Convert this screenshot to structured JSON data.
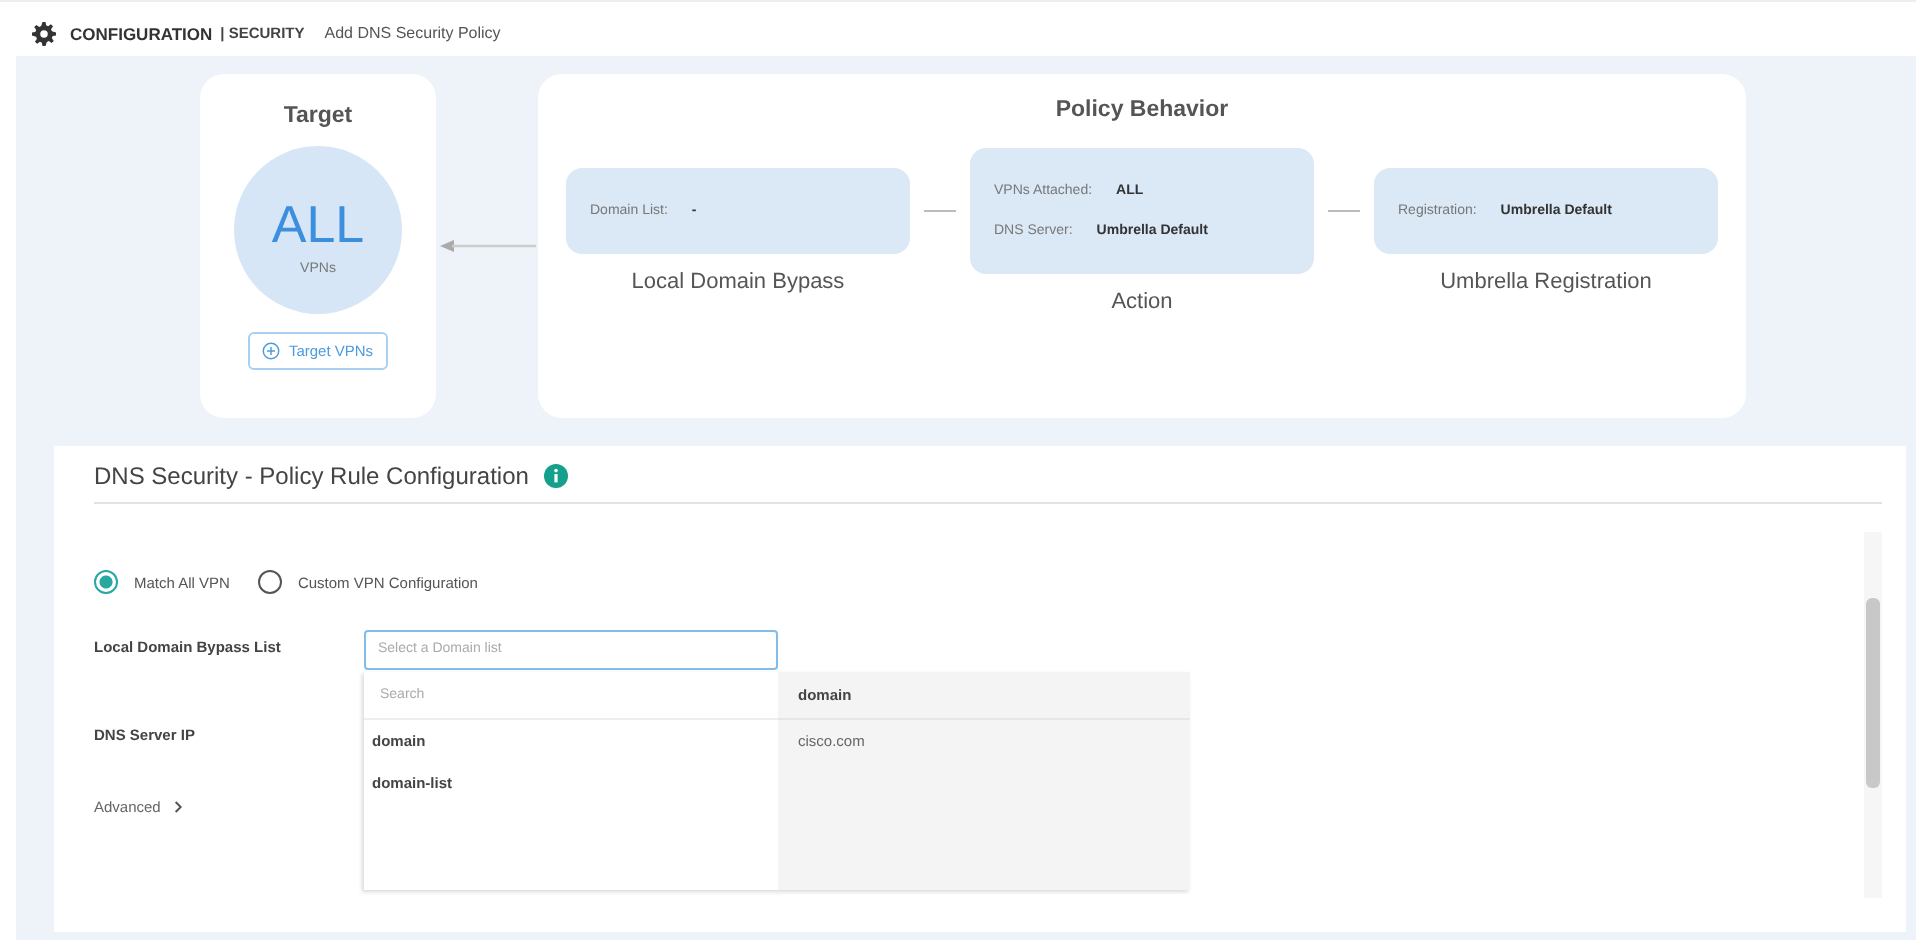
{
  "header": {
    "section": "CONFIGURATION",
    "subsection": "| SECURITY",
    "page": "Add DNS Security Policy"
  },
  "target": {
    "title": "Target",
    "value": "ALL",
    "unit": "VPNs",
    "button": "Target VPNs"
  },
  "policy_behavior": {
    "title": "Policy Behavior",
    "steps": [
      {
        "title": "Local Domain Bypass",
        "fields": [
          {
            "label": "Domain List:",
            "value": "-"
          }
        ]
      },
      {
        "title": "Action",
        "fields": [
          {
            "label": "VPNs Attached:",
            "value": "ALL"
          },
          {
            "label": "DNS Server:",
            "value": "Umbrella Default"
          }
        ]
      },
      {
        "title": "Umbrella Registration",
        "fields": [
          {
            "label": "Registration:",
            "value": "Umbrella Default"
          }
        ]
      }
    ]
  },
  "rule_config": {
    "title": "DNS Security - Policy Rule Configuration",
    "options": [
      {
        "label": "Match All VPN",
        "selected": true
      },
      {
        "label": "Custom VPN Configuration",
        "selected": false
      }
    ],
    "domain_field": {
      "label": "Local Domain Bypass List",
      "placeholder": "Select a Domain list"
    },
    "dns_label": "DNS Server IP",
    "advanced": "Advanced",
    "dropdown": {
      "search_placeholder": "Search",
      "items": [
        "domain",
        "domain-list"
      ],
      "preview_header": "domain",
      "preview_rows": [
        "cisco.com"
      ]
    }
  }
}
